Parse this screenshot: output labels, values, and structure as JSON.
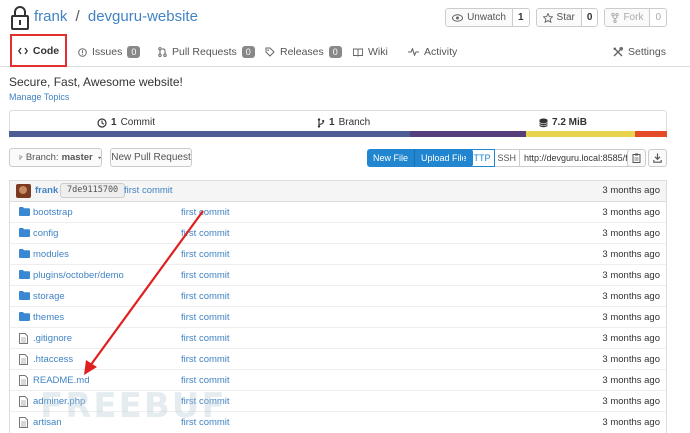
{
  "header": {
    "owner": "frank",
    "separator": "/",
    "repo": "devguru-website",
    "watch": {
      "label": "Unwatch",
      "count": "1"
    },
    "star": {
      "label": "Star",
      "count": "0"
    },
    "fork": {
      "label": "Fork",
      "count": "0"
    }
  },
  "tabs": [
    {
      "label": "Code"
    },
    {
      "label": "Issues",
      "badge": "0"
    },
    {
      "label": "Pull Requests",
      "badge": "0"
    },
    {
      "label": "Releases",
      "badge": "0"
    },
    {
      "label": "Wiki"
    },
    {
      "label": "Activity"
    },
    {
      "label": "Settings"
    }
  ],
  "description": "Secure, Fast, Awesome website!",
  "manage_topics": "Manage Topics",
  "stats": {
    "commits": {
      "count": "1",
      "label": "Commit"
    },
    "branches": {
      "count": "1",
      "label": "Branch"
    },
    "size": "7.2 MiB"
  },
  "language_colors": [
    "#4F5D95",
    "#563d7c",
    "#e9d34d",
    "#e34c26"
  ],
  "language_fractions": [
    0.609,
    0.176,
    0.167,
    0.048
  ],
  "toolbar": {
    "branch_prefix": "Branch:",
    "branch": "master",
    "new_pull_request": "New Pull Request",
    "new_file": "New File",
    "upload_file": "Upload File",
    "http": "HTTP",
    "ssh": "SSH",
    "clone_url": "http://devguru.local:8585/frank/d"
  },
  "latest_commit": {
    "author": "frank",
    "sha": "7de9115700",
    "message": "first commit",
    "time": "3 months ago"
  },
  "files": [
    {
      "name": "bootstrap",
      "type": "dir",
      "message": "first commit",
      "time": "3 months ago"
    },
    {
      "name": "config",
      "type": "dir",
      "message": "first commit",
      "time": "3 months ago"
    },
    {
      "name": "modules",
      "type": "dir",
      "message": "first commit",
      "time": "3 months ago"
    },
    {
      "name": "plugins/october/",
      "name_tail": "demo",
      "type": "dir",
      "message": "first commit",
      "time": "3 months ago"
    },
    {
      "name": "storage",
      "type": "dir",
      "message": "first commit",
      "time": "3 months ago"
    },
    {
      "name": "themes",
      "type": "dir",
      "message": "first commit",
      "time": "3 months ago"
    },
    {
      "name": ".gitignore",
      "type": "file",
      "message": "first commit",
      "time": "3 months ago"
    },
    {
      "name": ".htaccess",
      "type": "file",
      "message": "first commit",
      "time": "3 months ago"
    },
    {
      "name": "README.md",
      "type": "file",
      "message": "first commit",
      "time": "3 months ago"
    },
    {
      "name": "adminer.php",
      "type": "file",
      "message": "first commit",
      "time": "3 months ago"
    },
    {
      "name": "artisan",
      "type": "file",
      "message": "first commit",
      "time": "3 months ago"
    }
  ],
  "annotation_color": "#e02020"
}
